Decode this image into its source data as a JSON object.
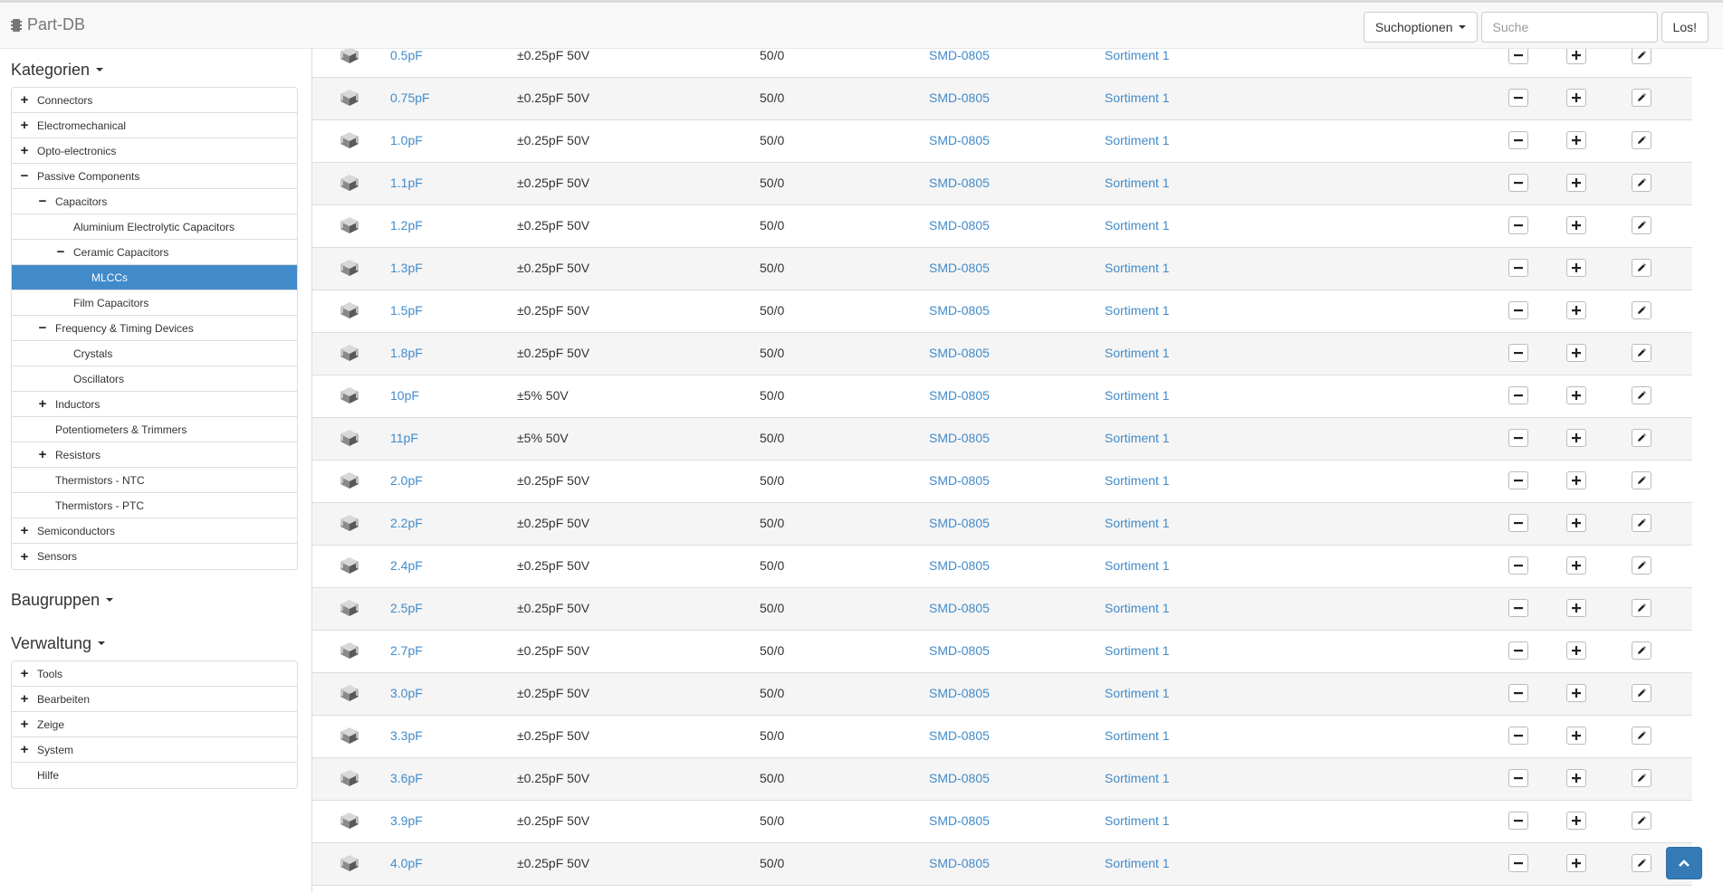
{
  "navbar": {
    "brand": "Part-DB",
    "search_options_label": "Suchoptionen",
    "search_placeholder": "Suche",
    "search_value": "",
    "go_label": "Los!"
  },
  "sidebar": {
    "categories_title": "Kategorien",
    "categories": [
      {
        "label": "Connectors",
        "depth": 0,
        "toggle": "+"
      },
      {
        "label": "Electromechanical",
        "depth": 0,
        "toggle": "+"
      },
      {
        "label": "Opto-electronics",
        "depth": 0,
        "toggle": "+"
      },
      {
        "label": "Passive Components",
        "depth": 0,
        "toggle": "−"
      },
      {
        "label": "Capacitors",
        "depth": 1,
        "toggle": "−"
      },
      {
        "label": "Aluminium Electrolytic Capacitors",
        "depth": 2,
        "toggle": ""
      },
      {
        "label": "Ceramic Capacitors",
        "depth": 2,
        "toggle": "−"
      },
      {
        "label": "MLCCs",
        "depth": 3,
        "toggle": "",
        "selected": true
      },
      {
        "label": "Film Capacitors",
        "depth": 2,
        "toggle": ""
      },
      {
        "label": "Frequency & Timing Devices",
        "depth": 1,
        "toggle": "−"
      },
      {
        "label": "Crystals",
        "depth": 2,
        "toggle": ""
      },
      {
        "label": "Oscillators",
        "depth": 2,
        "toggle": ""
      },
      {
        "label": "Inductors",
        "depth": 1,
        "toggle": "+"
      },
      {
        "label": "Potentiometers & Trimmers",
        "depth": 1,
        "toggle": ""
      },
      {
        "label": "Resistors",
        "depth": 1,
        "toggle": "+"
      },
      {
        "label": "Thermistors - NTC",
        "depth": 1,
        "toggle": ""
      },
      {
        "label": "Thermistors - PTC",
        "depth": 1,
        "toggle": ""
      },
      {
        "label": "Semiconductors",
        "depth": 0,
        "toggle": "+"
      },
      {
        "label": "Sensors",
        "depth": 0,
        "toggle": "+"
      }
    ],
    "groups_title": "Baugruppen",
    "admin_title": "Verwaltung",
    "admin": [
      {
        "label": "Tools",
        "toggle": "+"
      },
      {
        "label": "Bearbeiten",
        "toggle": "+"
      },
      {
        "label": "Zeige",
        "toggle": "+"
      },
      {
        "label": "System",
        "toggle": "+"
      },
      {
        "label": "Hilfe",
        "toggle": ""
      }
    ]
  },
  "parts": [
    {
      "name": "0.5pF",
      "description": "±0.25pF 50V",
      "stock": "50/0",
      "footprint": "SMD-0805",
      "location": "Sortiment 1"
    },
    {
      "name": "0.75pF",
      "description": "±0.25pF 50V",
      "stock": "50/0",
      "footprint": "SMD-0805",
      "location": "Sortiment 1"
    },
    {
      "name": "1.0pF",
      "description": "±0.25pF 50V",
      "stock": "50/0",
      "footprint": "SMD-0805",
      "location": "Sortiment 1"
    },
    {
      "name": "1.1pF",
      "description": "±0.25pF 50V",
      "stock": "50/0",
      "footprint": "SMD-0805",
      "location": "Sortiment 1"
    },
    {
      "name": "1.2pF",
      "description": "±0.25pF 50V",
      "stock": "50/0",
      "footprint": "SMD-0805",
      "location": "Sortiment 1"
    },
    {
      "name": "1.3pF",
      "description": "±0.25pF 50V",
      "stock": "50/0",
      "footprint": "SMD-0805",
      "location": "Sortiment 1"
    },
    {
      "name": "1.5pF",
      "description": "±0.25pF 50V",
      "stock": "50/0",
      "footprint": "SMD-0805",
      "location": "Sortiment 1"
    },
    {
      "name": "1.8pF",
      "description": "±0.25pF 50V",
      "stock": "50/0",
      "footprint": "SMD-0805",
      "location": "Sortiment 1"
    },
    {
      "name": "10pF",
      "description": "±5% 50V",
      "stock": "50/0",
      "footprint": "SMD-0805",
      "location": "Sortiment 1"
    },
    {
      "name": "11pF",
      "description": "±5% 50V",
      "stock": "50/0",
      "footprint": "SMD-0805",
      "location": "Sortiment 1"
    },
    {
      "name": "2.0pF",
      "description": "±0.25pF 50V",
      "stock": "50/0",
      "footprint": "SMD-0805",
      "location": "Sortiment 1"
    },
    {
      "name": "2.2pF",
      "description": "±0.25pF 50V",
      "stock": "50/0",
      "footprint": "SMD-0805",
      "location": "Sortiment 1"
    },
    {
      "name": "2.4pF",
      "description": "±0.25pF 50V",
      "stock": "50/0",
      "footprint": "SMD-0805",
      "location": "Sortiment 1"
    },
    {
      "name": "2.5pF",
      "description": "±0.25pF 50V",
      "stock": "50/0",
      "footprint": "SMD-0805",
      "location": "Sortiment 1"
    },
    {
      "name": "2.7pF",
      "description": "±0.25pF 50V",
      "stock": "50/0",
      "footprint": "SMD-0805",
      "location": "Sortiment 1"
    },
    {
      "name": "3.0pF",
      "description": "±0.25pF 50V",
      "stock": "50/0",
      "footprint": "SMD-0805",
      "location": "Sortiment 1"
    },
    {
      "name": "3.3pF",
      "description": "±0.25pF 50V",
      "stock": "50/0",
      "footprint": "SMD-0805",
      "location": "Sortiment 1"
    },
    {
      "name": "3.6pF",
      "description": "±0.25pF 50V",
      "stock": "50/0",
      "footprint": "SMD-0805",
      "location": "Sortiment 1"
    },
    {
      "name": "3.9pF",
      "description": "±0.25pF 50V",
      "stock": "50/0",
      "footprint": "SMD-0805",
      "location": "Sortiment 1"
    },
    {
      "name": "4.0pF",
      "description": "±0.25pF 50V",
      "stock": "50/0",
      "footprint": "SMD-0805",
      "location": "Sortiment 1"
    }
  ],
  "icons": {
    "brand": "chip-icon",
    "part": "capacitor-icon",
    "decrement": "minus-icon",
    "increment": "plus-icon",
    "edit": "pencil-icon",
    "scroll_top": "chevron-up-icon"
  },
  "colors": {
    "accent": "#428bca",
    "selected_bg": "#428bca",
    "scroll_button": "#337ab7"
  }
}
